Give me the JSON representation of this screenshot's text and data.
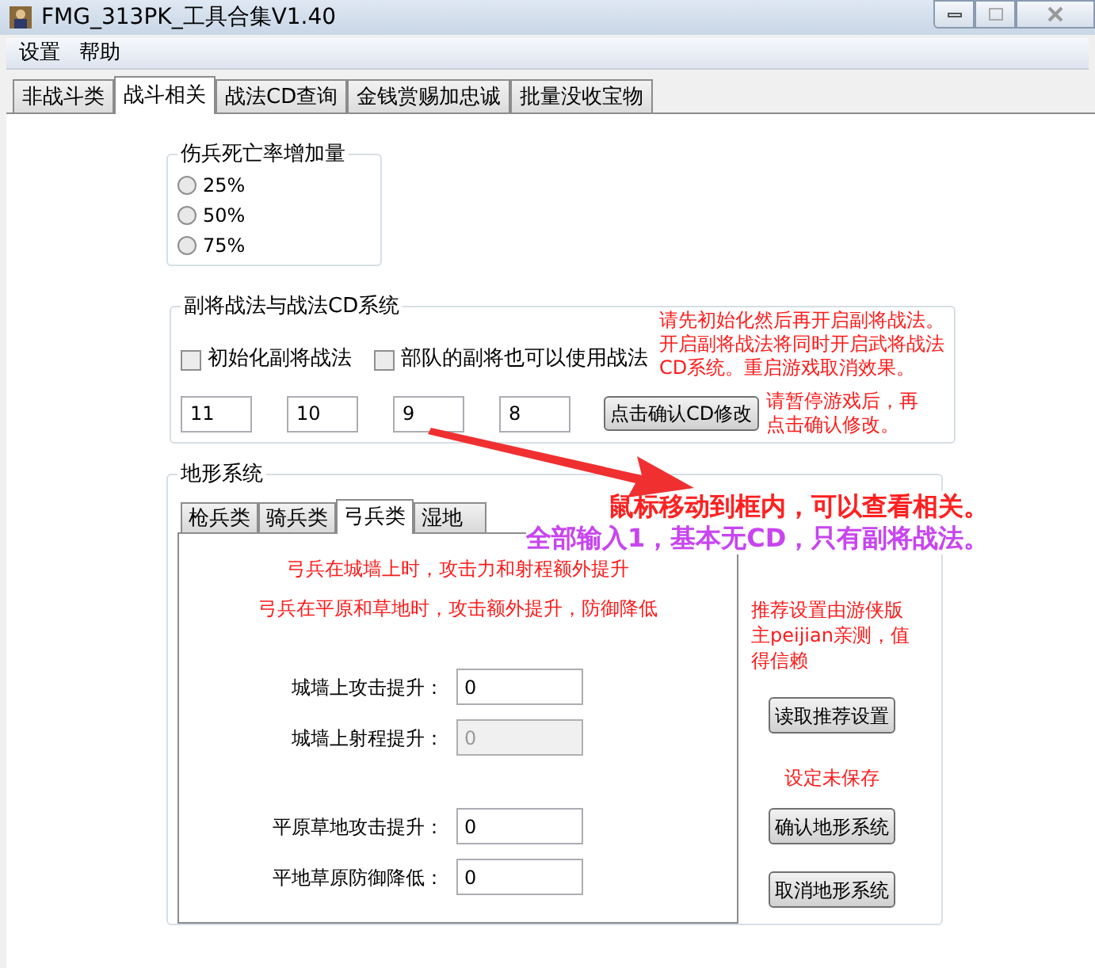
{
  "window": {
    "title": "FMG_313PK_工具合集V1.40"
  },
  "menu": [
    "设置",
    "帮助"
  ],
  "tabs": [
    {
      "label": "非战斗类",
      "selected": false
    },
    {
      "label": "战斗相关",
      "selected": true
    },
    {
      "label": "战法CD查询",
      "selected": false
    },
    {
      "label": "金钱赏赐加忠诚",
      "selected": false
    },
    {
      "label": "批量没收宝物",
      "selected": false
    }
  ],
  "casualty_group": {
    "title": "伤兵死亡率增加量",
    "options": [
      {
        "label": "25%",
        "selected": false
      },
      {
        "label": "50%",
        "selected": false
      },
      {
        "label": "75%",
        "selected": false
      }
    ]
  },
  "cd_group": {
    "title": "副将战法与战法CD系统",
    "checkboxes": [
      {
        "label": "初始化副将战法",
        "checked": false
      },
      {
        "label": "部队的副将也可以使用战法",
        "checked": false
      }
    ],
    "notice": "请先初始化然后再开启副将战法。开启副将战法将同时开启武将战法CD系统。重启游戏取消效果。",
    "fields": [
      "11",
      "10",
      "9",
      "8"
    ],
    "confirm_button": "点击确认CD修改",
    "confirm_note": "请暂停游戏后，再点击确认修改。"
  },
  "hints": [
    {
      "text": "鼠标移动到框内，可以查看相关。",
      "color": "#ff2020"
    },
    {
      "text": "全部输入1，基本无CD，只有副将战法。",
      "color": "#c845f0"
    }
  ],
  "terrain_group": {
    "title": "地形系统",
    "tabs": [
      {
        "label": "枪兵类",
        "selected": false
      },
      {
        "label": "骑兵类",
        "selected": false
      },
      {
        "label": "弓兵类",
        "selected": true
      },
      {
        "label": "湿地",
        "selected": false
      }
    ],
    "descriptions": [
      "弓兵在城墙上时，攻击力和射程额外提升",
      "弓兵在平原和草地时，攻击额外提升，防御降低"
    ],
    "wall_fields": [
      {
        "label": "城墙上攻击提升：",
        "value": "0",
        "disabled": false
      },
      {
        "label": "城墙上射程提升：",
        "value": "0",
        "disabled": true
      }
    ],
    "plain_fields": [
      {
        "label": "平原草地攻击提升：",
        "value": "0",
        "disabled": false
      },
      {
        "label": "平地草原防御降低：",
        "value": "0",
        "disabled": false
      }
    ],
    "recommend_note": "推荐设置由游侠版主peijian亲测，值得信赖",
    "load_button": "读取推荐设置",
    "status": "设定未保存",
    "confirm_button": "确认地形系统",
    "cancel_button": "取消地形系统"
  }
}
